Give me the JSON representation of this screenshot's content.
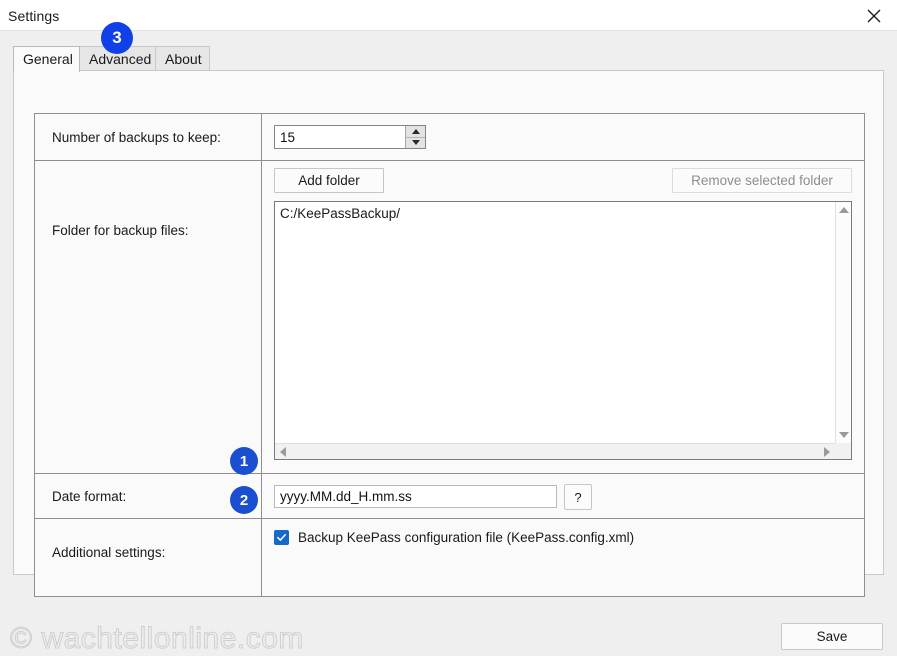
{
  "window": {
    "title": "Settings",
    "close_icon": "close-icon"
  },
  "tabs": [
    {
      "label": "General",
      "active": true
    },
    {
      "label": "Advanced",
      "active": false
    },
    {
      "label": "About",
      "active": false
    }
  ],
  "settings": {
    "backups_to_keep": {
      "label": "Number of backups to keep:",
      "value": "15",
      "spin_up_icon": "triangle-up-icon",
      "spin_down_icon": "triangle-down-icon"
    },
    "backup_folder": {
      "label": "Folder for backup files:",
      "add_button": "Add folder",
      "remove_button": "Remove selected folder",
      "remove_button_disabled": true,
      "folders": [
        "C:/KeePassBackup/"
      ],
      "scroll_up_icon": "scroll-arrow-up-icon",
      "scroll_down_icon": "scroll-arrow-down-icon",
      "scroll_left_icon": "scroll-arrow-left-icon",
      "scroll_right_icon": "scroll-arrow-right-icon"
    },
    "date_format": {
      "label": "Date format:",
      "value": "yyyy.MM.dd_H.mm.ss",
      "placeholder": "",
      "help_button": "?"
    },
    "additional": {
      "label": "Additional settings:",
      "checkbox_label": "Backup KeePass configuration file (KeePass.config.xml)",
      "checkbox_checked": true,
      "check_icon": "checkmark-icon"
    }
  },
  "footer": {
    "watermark": "© wachtellonline.com",
    "save_button": "Save"
  },
  "callouts": [
    {
      "number": "1",
      "target": "date-format-row"
    },
    {
      "number": "2",
      "target": "additional-settings-row"
    },
    {
      "number": "3",
      "target": "advanced-tab"
    }
  ],
  "colors": {
    "accent_blue": "#1040e8",
    "badge_blue": "#1a4fd1",
    "checkbox_blue": "#1569c9",
    "dialog_bg": "#efefef",
    "panel_bg": "#fafafa"
  }
}
